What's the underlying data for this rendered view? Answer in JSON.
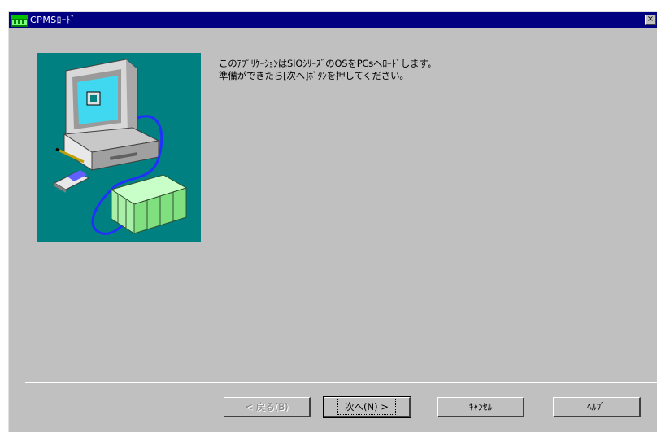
{
  "window": {
    "title": "CPMSﾛｰﾄﾞ",
    "close_glyph": "×"
  },
  "message": {
    "line1": "このｱﾌﾟﾘｹｰｼｮﾝはSIOｼﾘｰｽﾞのOSをPCsへﾛｰﾄﾞします。",
    "line2": "準備ができたら[次へ]ﾎﾞﾀﾝを押してください。"
  },
  "buttons": {
    "back": "< 戻る(B)",
    "next": "次へ(N) >",
    "cancel": "ｷｬﾝｾﾙ",
    "help": "ﾍﾙﾌﾟ"
  },
  "colors": {
    "titlebar": "#000080",
    "dialog_bg": "#c0c0c0",
    "illustration_bg": "#008080"
  },
  "icons": {
    "app": "plc-app-icon",
    "illustration": "computer-plc-illustration"
  }
}
